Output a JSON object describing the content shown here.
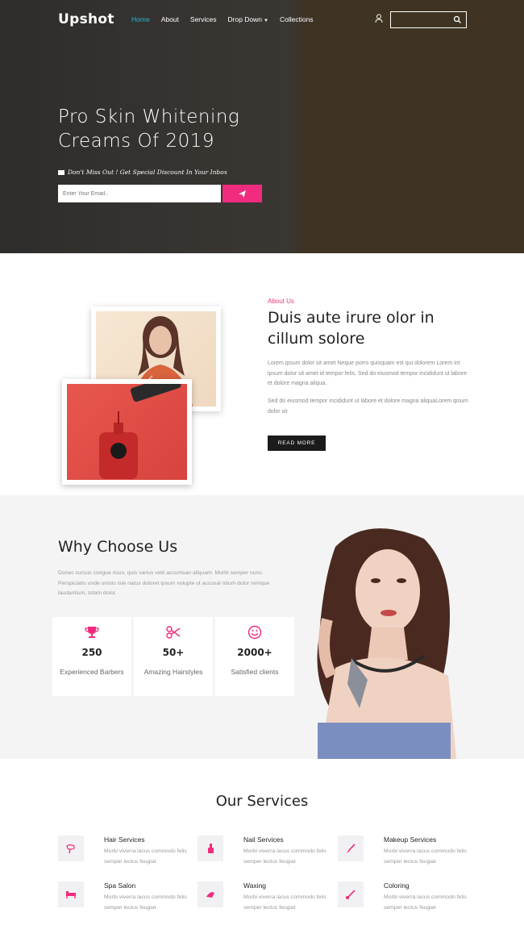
{
  "header": {
    "logo": "Upshot",
    "nav": [
      {
        "label": "Home",
        "active": true
      },
      {
        "label": "About",
        "active": false
      },
      {
        "label": "Services",
        "active": false
      },
      {
        "label": "Drop Down",
        "active": false,
        "dropdown": true
      },
      {
        "label": "Collections",
        "active": false
      }
    ],
    "icons": [
      "user-icon",
      "search-icon"
    ]
  },
  "hero": {
    "title": "Pro Skin Whitening Creams Of 2019",
    "subtitle": "Don't Miss Out ! Get Special Discount In Your Inbox",
    "email_placeholder": "Enter Your Email..",
    "accent_color": "#f12b7e"
  },
  "about": {
    "tag": "About Us",
    "title": "Duis aute irure olor in cillum solore",
    "para1": "Lorem ipsum dolor sit amet Neque porro quisquam est qui dolorem Lorem int ipsum dolor sit amet id tempor felis. Sed do eiusmod tempor incididunt ut labore et dolore magna aliqua.",
    "para2": "Sed do eiusmod tempor incididunt ut labore et dolore magna aliquaLorem ipsum dolor sit",
    "button": "READ MORE"
  },
  "why": {
    "title": "Why Choose Us",
    "text": "Donec cursus congue risus, quis varius velit accumsan aliquam. Morbi semper nunc. Perspiciatis unde omnis iste natus doloret ipsum volupte ut accusal ntium dolor remque laudantium, totam dolor.",
    "stats": [
      {
        "icon": "trophy-icon",
        "value": "250",
        "label": "Experienced Barbers"
      },
      {
        "icon": "scissors-icon",
        "value": "50+",
        "label": "Amazing Hairstyles"
      },
      {
        "icon": "smile-icon",
        "value": "2000+",
        "label": "Satisfied clients"
      }
    ]
  },
  "services": {
    "title": "Our Services",
    "items": [
      {
        "icon": "hair-dryer-icon",
        "title": "Hair Services",
        "desc": "Morbi viverra lacus commodo felis semper lectus feugiat"
      },
      {
        "icon": "nail-polish-icon",
        "title": "Nail Services",
        "desc": "Morbi viverra lacus commodo felis semper lectus feugiat"
      },
      {
        "icon": "makeup-brush-icon",
        "title": "Makeup Services",
        "desc": "Morbi viverra lacus commodo felis semper lectus feugiat"
      },
      {
        "icon": "spa-bed-icon",
        "title": "Spa Salon",
        "desc": "Morbi viverra lacus commodo felis semper lectus feugiat"
      },
      {
        "icon": "wax-icon",
        "title": "Waxing",
        "desc": "Morbi viverra lacus commodo felis semper lectus feugiat"
      },
      {
        "icon": "color-brush-icon",
        "title": "Coloring",
        "desc": "Morbi viverra lacus commodo felis semper lectus feugiat"
      }
    ]
  }
}
